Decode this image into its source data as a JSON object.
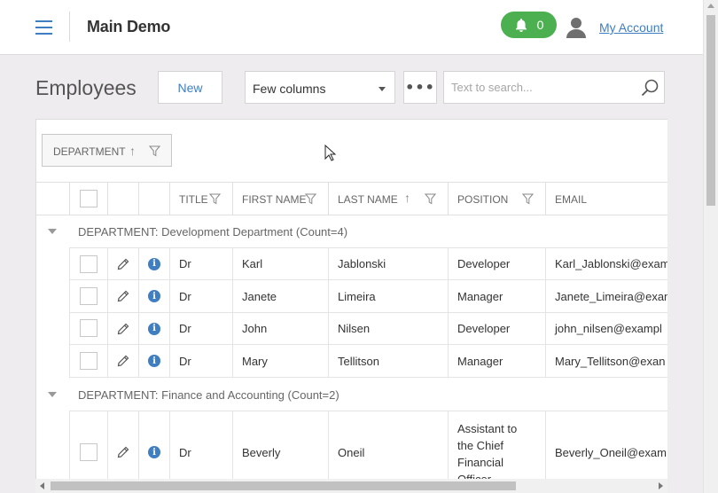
{
  "header": {
    "app_title": "Main Demo",
    "notification_count": "0",
    "account_label": "My Account"
  },
  "toolbar": {
    "page_title": "Employees",
    "new_label": "New",
    "columns_select_value": "Few columns",
    "more_label": "•••",
    "search_placeholder": "Text to search..."
  },
  "grid": {
    "group_panel_label": "DEPARTMENT",
    "columns": [
      "TITLE",
      "FIRST NAME",
      "LAST NAME",
      "POSITION",
      "EMAIL"
    ],
    "groups": [
      {
        "label": "DEPARTMENT: Development Department (Count=4)",
        "rows": [
          {
            "title": "Dr",
            "first": "Karl",
            "last": "Jablonski",
            "position": "Developer",
            "email": "Karl_Jablonski@exam"
          },
          {
            "title": "Dr",
            "first": "Janete",
            "last": "Limeira",
            "position": "Manager",
            "email": "Janete_Limeira@exan"
          },
          {
            "title": "Dr",
            "first": "John",
            "last": "Nilsen",
            "position": "Developer",
            "email": "john_nilsen@exampl"
          },
          {
            "title": "Dr",
            "first": "Mary",
            "last": "Tellitson",
            "position": "Manager",
            "email": "Mary_Tellitson@exan"
          }
        ]
      },
      {
        "label": "DEPARTMENT: Finance and Accounting (Count=2)",
        "rows": [
          {
            "title": "Dr",
            "first": "Beverly",
            "last": "Oneil",
            "position": "Assistant to the Chief Financial Officer",
            "email": "Beverly_Oneil@exam"
          }
        ]
      }
    ]
  },
  "colors": {
    "accent": "#3f7ec1",
    "notification_badge": "#4caf50"
  },
  "icons": [
    "menu-icon",
    "bell-icon",
    "user-icon",
    "search-icon",
    "filter-icon",
    "sort-asc-icon",
    "pencil-icon",
    "info-icon",
    "collapse-triangle-icon"
  ]
}
